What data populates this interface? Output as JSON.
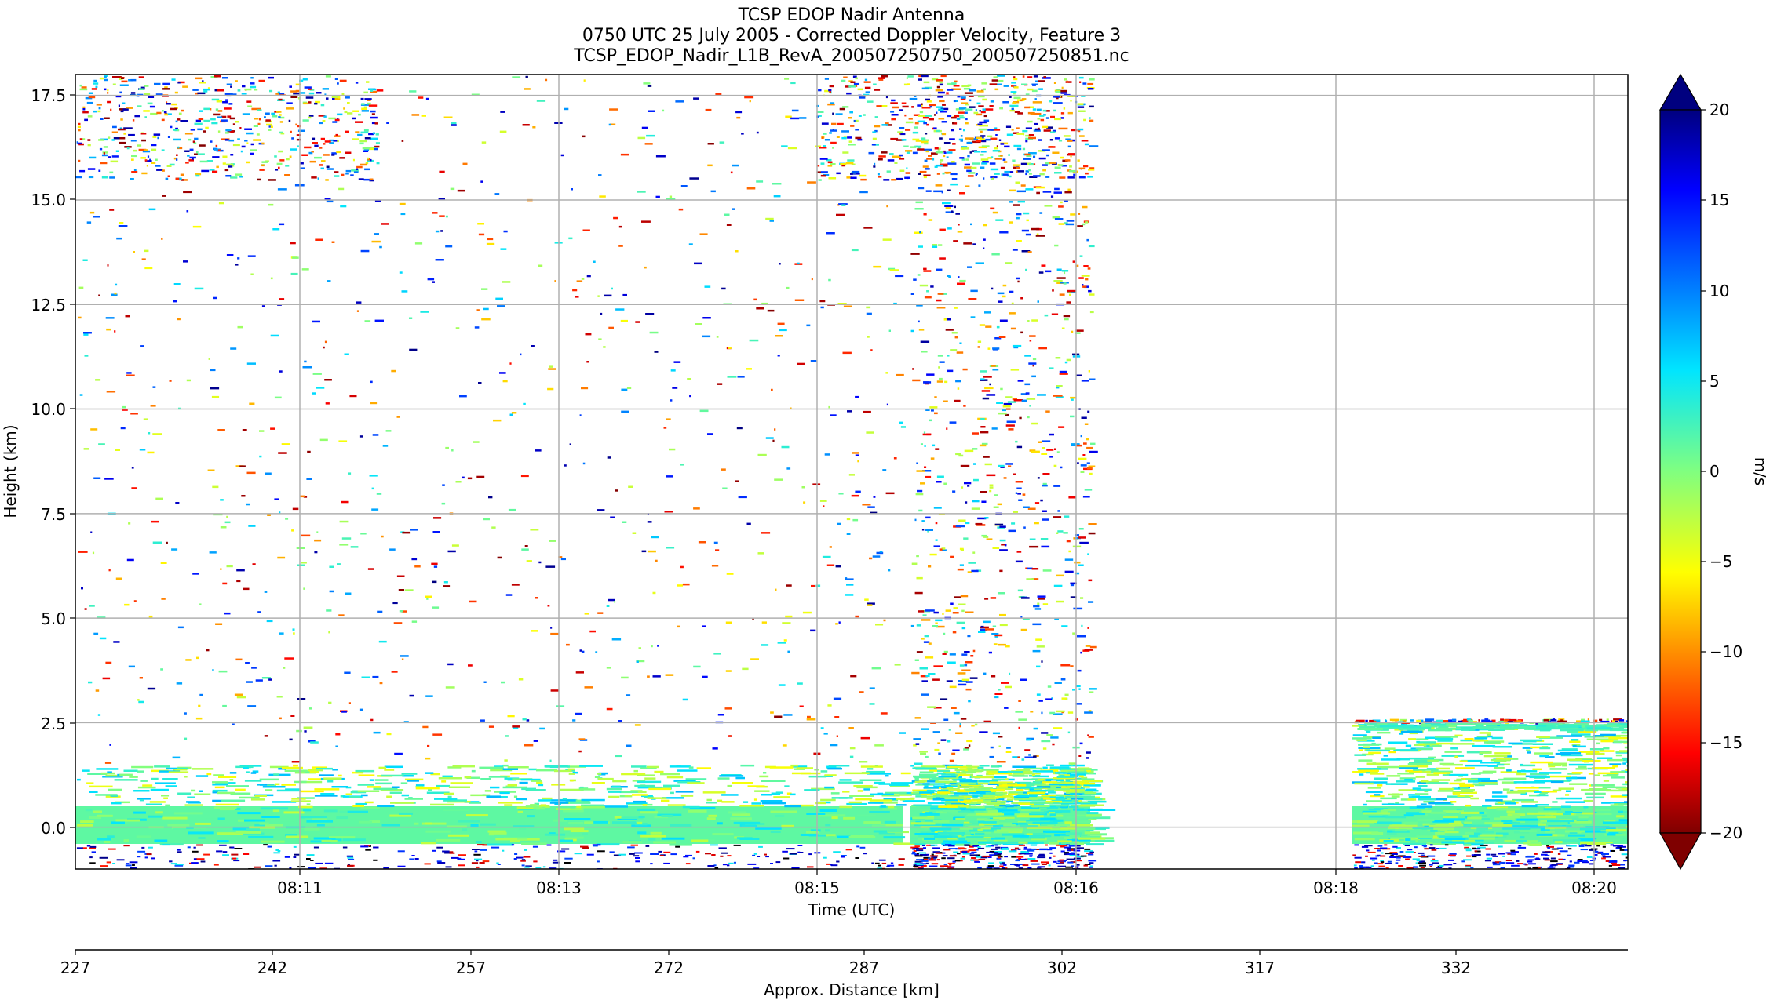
{
  "chart_data": {
    "type": "heatmap",
    "title_lines": [
      "TCSP EDOP Nadir Antenna",
      "0750 UTC 25 July 2005 - Corrected Doppler Velocity, Feature 3",
      "TCSP_EDOP_Nadir_L1B_RevA_200507250750_200507250851.nc"
    ],
    "xlabel": "Time (UTC)",
    "ylabel": "Height (km)",
    "x_ticks": [
      "08:11",
      "08:13",
      "08:15",
      "08:16",
      "08:18",
      "08:20"
    ],
    "y_ticks": [
      "0.0",
      "2.5",
      "5.0",
      "7.5",
      "10.0",
      "12.5",
      "15.0",
      "17.5"
    ],
    "y_tick_values": [
      0.0,
      2.5,
      5.0,
      7.5,
      10.0,
      12.5,
      15.0,
      17.5
    ],
    "ylim": [
      -1.0,
      18.0
    ],
    "grid": true,
    "secondary_axis": {
      "label": "Approx. Distance [km]",
      "ticks": [
        "227",
        "242",
        "257",
        "272",
        "287",
        "302",
        "317",
        "332"
      ]
    },
    "colorbar": {
      "label": "m/s",
      "ticks": [
        "20",
        "15",
        "10",
        "5",
        "0",
        "−10",
        "−15",
        "−20"
      ],
      "tick_values": [
        20,
        15,
        10,
        5,
        0,
        -10,
        -15,
        -20
      ],
      "minus5_label": "−5",
      "range": [
        -20,
        20
      ],
      "colormap": "jet_r",
      "extend": "both"
    },
    "data_regions": [
      {
        "segment": "A",
        "echo_top_km": 18.0,
        "surface_band_km": [
          -1.0,
          0.5
        ],
        "low_cloud_top_km": 1.5
      },
      {
        "segment": "B",
        "echo_top_km": 18.0,
        "surface_band_km": [
          -1.0,
          0.5
        ],
        "low_cloud_top_km": 1.5
      },
      {
        "segment": "C",
        "echo_top_km": 2.6,
        "surface_band_km": [
          -1.0,
          0.5
        ],
        "low_cloud_top_km": 2.5
      }
    ]
  }
}
